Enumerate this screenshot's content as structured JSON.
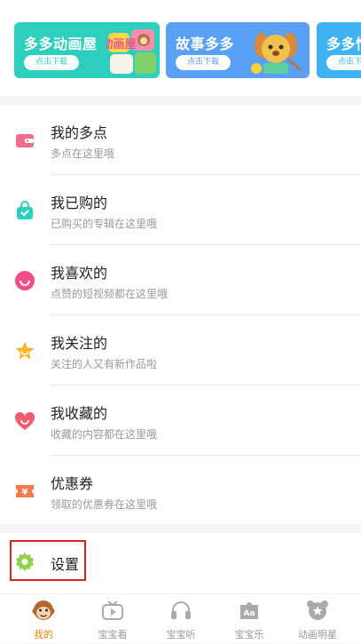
{
  "banners": [
    {
      "title": "多多动画屋",
      "button": "点击下载",
      "color": "#2fcfbf",
      "art_text": "动画屋"
    },
    {
      "title": "故事多多",
      "button": "点击下载",
      "color": "#5aa0f6"
    },
    {
      "title": "多多忙",
      "button": "点击下载",
      "color": "#3fb2f2"
    }
  ],
  "menu": [
    {
      "title": "我的多点",
      "subtitle": "多点在这里哦",
      "icon": "wallet-icon",
      "color": "#f26b8a"
    },
    {
      "title": "我已购的",
      "subtitle": "已购买的专辑在这里哦",
      "icon": "shopping-bag-icon",
      "color": "#2ad0c0"
    },
    {
      "title": "我喜欢的",
      "subtitle": "点赞的短视频都在这里哦",
      "icon": "smile-icon",
      "color": "#f24f8a"
    },
    {
      "title": "我关注的",
      "subtitle": "关注的人又有新作品啦",
      "icon": "star-icon",
      "color": "#f7b52c"
    },
    {
      "title": "我收藏的",
      "subtitle": "收藏的内容都在这里哦",
      "icon": "heart-icon",
      "color": "#f25a6e"
    },
    {
      "title": "优惠券",
      "subtitle": "领取的优惠券在这里哦",
      "icon": "coupon-icon",
      "color": "#f57c4a"
    }
  ],
  "settings": {
    "label": "设置",
    "icon": "gear-icon",
    "color": "#8fd14f"
  },
  "tabs": [
    {
      "label": "我的",
      "icon": "monkey-icon",
      "active": true
    },
    {
      "label": "宝宝看",
      "icon": "tv-icon",
      "active": false
    },
    {
      "label": "宝宝听",
      "icon": "headphones-icon",
      "active": false
    },
    {
      "label": "宝宝乐",
      "icon": "puzzle-icon",
      "icon_text": "Aa",
      "active": false
    },
    {
      "label": "动画明星",
      "icon": "bear-star-icon",
      "active": false
    }
  ],
  "colors": {
    "accent": "#f08a1a",
    "inactive": "#999999",
    "highlight": "#e02020"
  }
}
